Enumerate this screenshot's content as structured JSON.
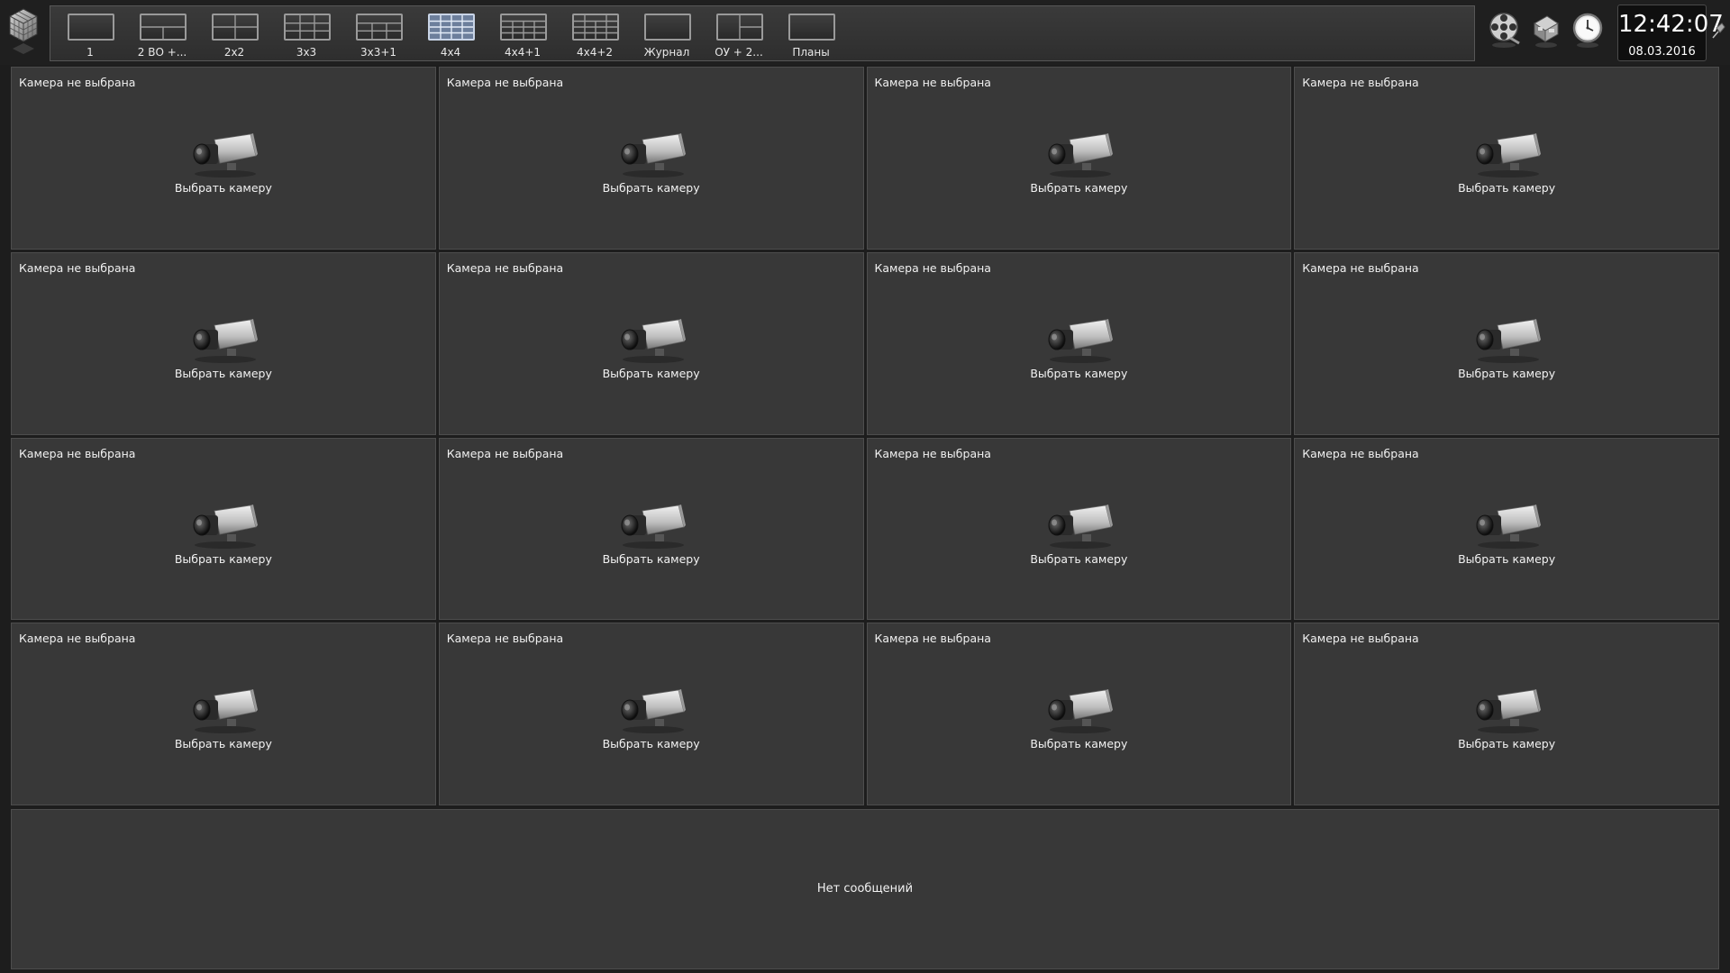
{
  "layouts": [
    {
      "label": "1",
      "active": false,
      "icon": "layout-1-icon"
    },
    {
      "label": "2 ВО +...",
      "active": false,
      "icon": "layout-2vo-icon"
    },
    {
      "label": "2x2",
      "active": false,
      "icon": "layout-2x2-icon"
    },
    {
      "label": "3x3",
      "active": false,
      "icon": "layout-3x3-icon"
    },
    {
      "label": "3x3+1",
      "active": false,
      "icon": "layout-3x3plus1-icon"
    },
    {
      "label": "4x4",
      "active": true,
      "icon": "layout-4x4-icon"
    },
    {
      "label": "4x4+1",
      "active": false,
      "icon": "layout-4x4plus1-icon"
    },
    {
      "label": "4x4+2",
      "active": false,
      "icon": "layout-4x4plus2-icon"
    },
    {
      "label": "Журнал",
      "active": false,
      "icon": "journal-icon"
    },
    {
      "label": "ОУ + 2...",
      "active": false,
      "icon": "layout-ou2-icon"
    },
    {
      "label": "Планы",
      "active": false,
      "icon": "plans-icon"
    }
  ],
  "toolbar": {
    "icons": [
      "film-reel-icon",
      "cube-tools-icon",
      "alarm-clock-icon",
      "pin-icon"
    ]
  },
  "clock": {
    "time": "12:42:07",
    "date": "08.03.2016"
  },
  "cameras": {
    "title": "Камера не выбрана",
    "action": "Выбрать камеру",
    "count": 16
  },
  "messages": {
    "text": "Нет сообщений"
  },
  "colors": {
    "background": "#1d1d1d",
    "panel": "#383838",
    "active_layout": "#6d7f9c"
  }
}
